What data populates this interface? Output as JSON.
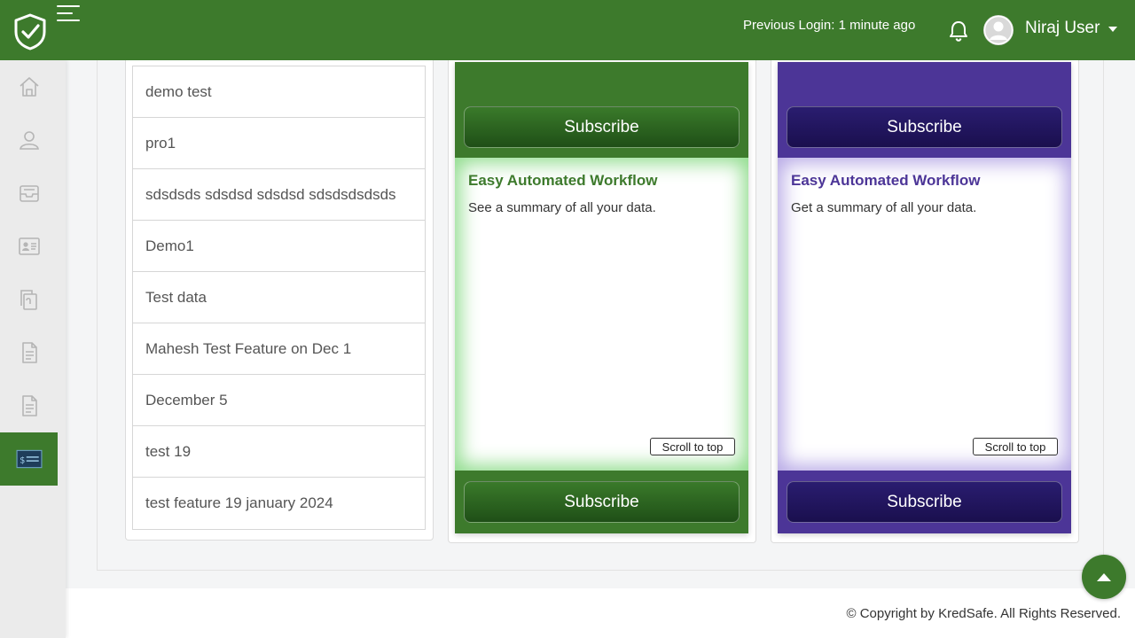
{
  "header": {
    "previous_login": "Previous Login: 1 minute ago",
    "username": "Niraj User",
    "logo_icon": "shield-check-icon",
    "colors": {
      "brand": "#3d7a2c"
    }
  },
  "sidebar": {
    "items": [
      {
        "icon": "home-icon"
      },
      {
        "icon": "user-icon"
      },
      {
        "icon": "inbox-icon"
      },
      {
        "icon": "id-card-icon"
      },
      {
        "icon": "documents-icon"
      },
      {
        "icon": "file-icon"
      },
      {
        "icon": "file-text-icon"
      },
      {
        "icon": "billing-icon",
        "active": true
      }
    ]
  },
  "features": [
    "demo test",
    "pro1",
    "sdsdsds sdsdsd sdsdsd sdsdsdsdsds",
    "Demo1",
    "Test data",
    "Mahesh Test Feature on Dec 1",
    "December 5",
    "test 19",
    "test feature 19 january 2024"
  ],
  "plans": [
    {
      "subscribe_top": "Subscribe",
      "title": "Easy Automated Workflow",
      "description": "See a summary of all your data.",
      "scroll_to_top": "Scroll to top",
      "subscribe_bottom": "Subscribe",
      "color": "#3d7a2c"
    },
    {
      "subscribe_top": "Subscribe",
      "title": "Easy Automated Workflow",
      "description": "Get a summary of all your data.",
      "scroll_to_top": "Scroll to top",
      "subscribe_bottom": "Subscribe",
      "color": "#4c3597"
    }
  ],
  "footer": {
    "copyright": "© Copyright by KredSafe. All Rights Reserved."
  }
}
